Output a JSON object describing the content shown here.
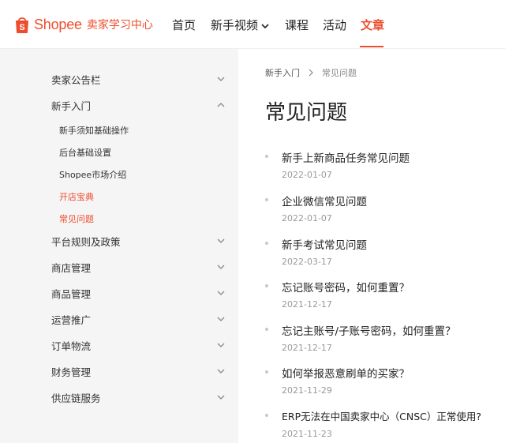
{
  "header": {
    "logo_text": "Shopee",
    "logo_subtitle": "卖家学习中心",
    "nav": [
      {
        "label": "首页",
        "active": false
      },
      {
        "label": "新手视频",
        "active": false,
        "dropdown": true
      },
      {
        "label": "课程",
        "active": false
      },
      {
        "label": "活动",
        "active": false
      },
      {
        "label": "文章",
        "active": true
      }
    ]
  },
  "sidebar": {
    "items": [
      {
        "label": "卖家公告栏",
        "expanded": false
      },
      {
        "label": "新手入门",
        "expanded": true,
        "children": [
          {
            "label": "新手须知基础操作",
            "active": false
          },
          {
            "label": "后台基础设置",
            "active": false
          },
          {
            "label": "Shopee市场介绍",
            "active": false
          },
          {
            "label": "开店宝典",
            "active": true
          },
          {
            "label": "常见问题",
            "active": true
          }
        ]
      },
      {
        "label": "平台规则及政策",
        "expanded": false
      },
      {
        "label": "商店管理",
        "expanded": false
      },
      {
        "label": "商品管理",
        "expanded": false
      },
      {
        "label": "运营推广",
        "expanded": false
      },
      {
        "label": "订单物流",
        "expanded": false
      },
      {
        "label": "财务管理",
        "expanded": false
      },
      {
        "label": "供应链服务",
        "expanded": false
      }
    ]
  },
  "main": {
    "breadcrumb": [
      "新手入门",
      "常见问题"
    ],
    "title": "常见问题",
    "articles": [
      {
        "title": "新手上新商品任务常见问题",
        "date": "2022-01-07"
      },
      {
        "title": "企业微信常见问题",
        "date": "2022-01-07"
      },
      {
        "title": "新手考试常见问题",
        "date": "2022-03-17"
      },
      {
        "title": "忘记账号密码，如何重置？",
        "date": "2021-12-17"
      },
      {
        "title": "忘记主账号/子账号密码，如何重置？",
        "date": "2021-12-17"
      },
      {
        "title": "如何举报恶意刷单的买家？",
        "date": "2021-11-29"
      },
      {
        "title": "ERP无法在中国卖家中心（CNSC）正常使用?",
        "date": "2021-11-23"
      }
    ]
  },
  "colors": {
    "accent": "#ee4d2d",
    "sidebar_bg": "#f5f5f5"
  }
}
